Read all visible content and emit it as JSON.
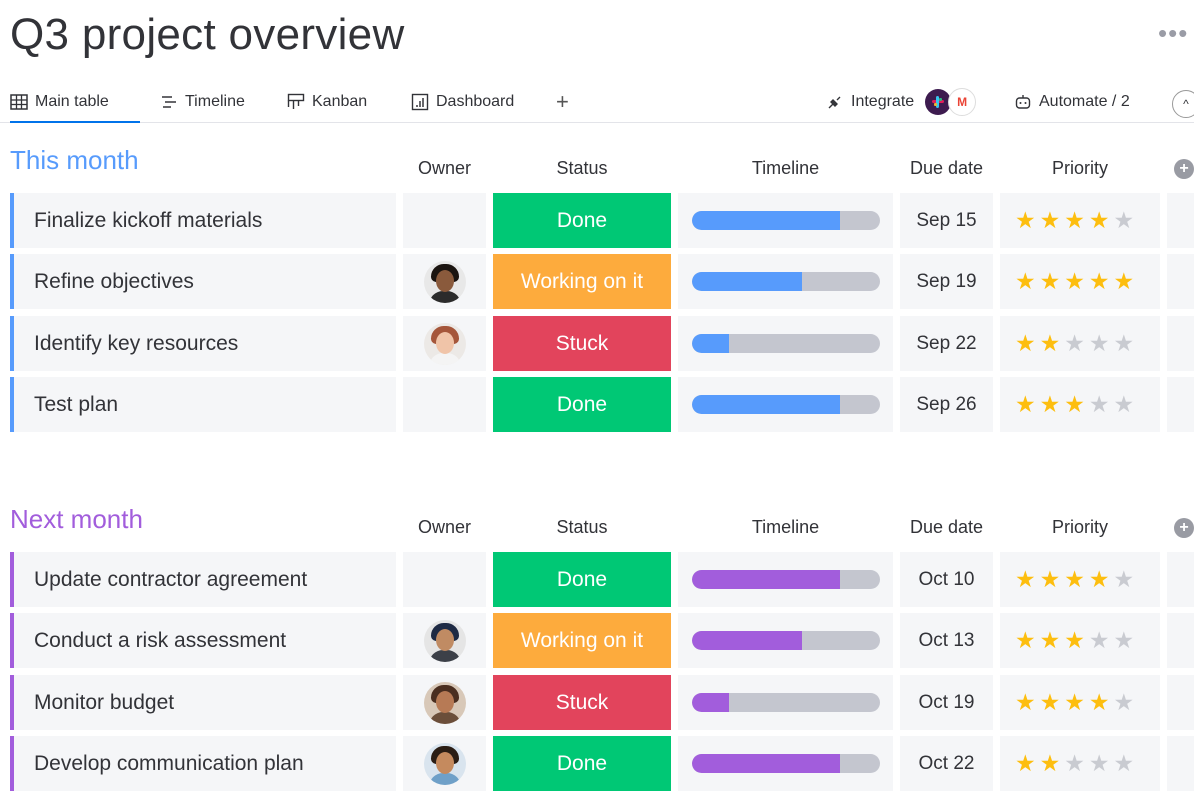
{
  "page": {
    "title": "Q3 project overview",
    "more": "•••"
  },
  "tabs": [
    {
      "label": "Main table",
      "icon": "table-icon",
      "active": true
    },
    {
      "label": "Timeline",
      "icon": "timeline-icon"
    },
    {
      "label": "Kanban",
      "icon": "kanban-icon"
    },
    {
      "label": "Dashboard",
      "icon": "dashboard-icon"
    }
  ],
  "toolbar": {
    "add": "+",
    "integrate_label": "Integrate",
    "automate_label": "Automate / 2",
    "gmail_letter": "M",
    "scroll_icon": "^"
  },
  "columns": {
    "owner": "Owner",
    "status": "Status",
    "timeline": "Timeline",
    "due_date": "Due date",
    "priority": "Priority",
    "add_column": "+"
  },
  "colors": {
    "this_month": "#579bfc",
    "next_month": "#a25ddc",
    "done": "#00c875",
    "working": "#fdab3d",
    "stuck": "#e2445c",
    "star": "#fdbe0f"
  },
  "groups": [
    {
      "title": "This month",
      "color": "#579bfc",
      "rows": [
        {
          "name": "Finalize kickoff materials",
          "owner": null,
          "status": "Done",
          "status_color": "#00c875",
          "timeline_progress": 0.79,
          "due": "Sep 15",
          "priority": 4
        },
        {
          "name": "Refine objectives",
          "owner": "avatar-1",
          "status": "Working on it",
          "status_color": "#fdab3d",
          "timeline_progress": 0.59,
          "due": "Sep 19",
          "priority": 5
        },
        {
          "name": "Identify key resources",
          "owner": "avatar-2",
          "status": "Stuck",
          "status_color": "#e2445c",
          "timeline_progress": 0.2,
          "due": "Sep 22",
          "priority": 2
        },
        {
          "name": "Test plan",
          "owner": null,
          "status": "Done",
          "status_color": "#00c875",
          "timeline_progress": 0.79,
          "due": "Sep 26",
          "priority": 3
        }
      ]
    },
    {
      "title": "Next month",
      "color": "#a25ddc",
      "rows": [
        {
          "name": "Update contractor agreement",
          "owner": null,
          "status": "Done",
          "status_color": "#00c875",
          "timeline_progress": 0.79,
          "due": "Oct 10",
          "priority": 4
        },
        {
          "name": "Conduct a risk assessment",
          "owner": "avatar-3",
          "status": "Working on it",
          "status_color": "#fdab3d",
          "timeline_progress": 0.59,
          "due": "Oct 13",
          "priority": 3
        },
        {
          "name": "Monitor budget",
          "owner": "avatar-4",
          "status": "Stuck",
          "status_color": "#e2445c",
          "timeline_progress": 0.2,
          "due": "Oct 19",
          "priority": 4
        },
        {
          "name": "Develop communication plan",
          "owner": "avatar-5",
          "status": "Done",
          "status_color": "#00c875",
          "timeline_progress": 0.79,
          "due": "Oct 22",
          "priority": 2
        }
      ]
    }
  ]
}
